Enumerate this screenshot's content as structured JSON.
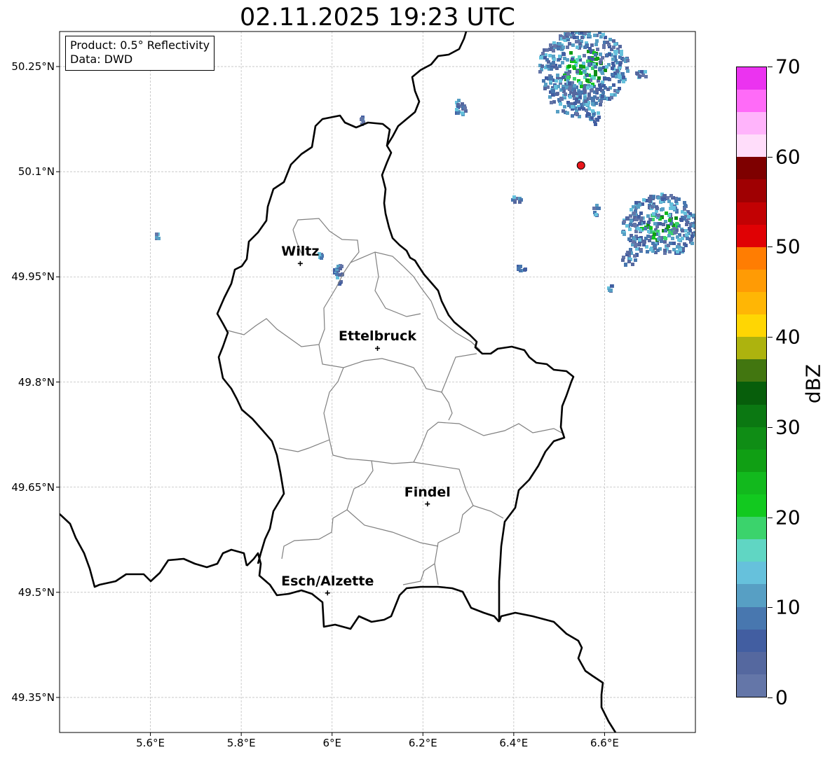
{
  "title": "02.11.2025 19:23 UTC",
  "info": {
    "product": "Product: 0.5° Reflectivity",
    "data": "Data: DWD"
  },
  "map": {
    "lat_labels": [
      "50.25°N",
      "50.1°N",
      "49.95°N",
      "49.8°N",
      "49.65°N",
      "49.5°N",
      "49.35°N"
    ],
    "lon_labels": [
      "5.6°E",
      "5.8°E",
      "6°E",
      "6.2°E",
      "6.4°E",
      "6.6°E"
    ],
    "cities": [
      {
        "name": "Wiltz",
        "lon": 5.93,
        "lat": 49.969
      },
      {
        "name": "Ettelbruck",
        "lon": 6.1,
        "lat": 49.848
      },
      {
        "name": "Findel",
        "lon": 6.21,
        "lat": 49.626
      },
      {
        "name": "Esch/Alzette",
        "lon": 5.99,
        "lat": 49.499
      }
    ],
    "radar_site": {
      "lon": 6.548,
      "lat": 50.109,
      "color": "#e8161b"
    }
  },
  "colorbar": {
    "unit": "dBZ",
    "ticks": [
      "0",
      "10",
      "20",
      "30",
      "40",
      "50",
      "60",
      "70"
    ],
    "colors": [
      "#6476a8",
      "#55689f",
      "#425ea1",
      "#4877af",
      "#579fc4",
      "#66c1dc",
      "#60d6c3",
      "#3bd36c",
      "#12c91f",
      "#12b91d",
      "#109f14",
      "#0f8d15",
      "#0b7812",
      "#075e0b",
      "#427610",
      "#adb30e",
      "#ffd603",
      "#ffb605",
      "#ff9b05",
      "#ff7d02",
      "#e00104",
      "#c20103",
      "#9f0002",
      "#7e0000",
      "#ffddfa",
      "#ffb4fb",
      "#ff6bf8",
      "#eb33f0"
    ]
  }
}
